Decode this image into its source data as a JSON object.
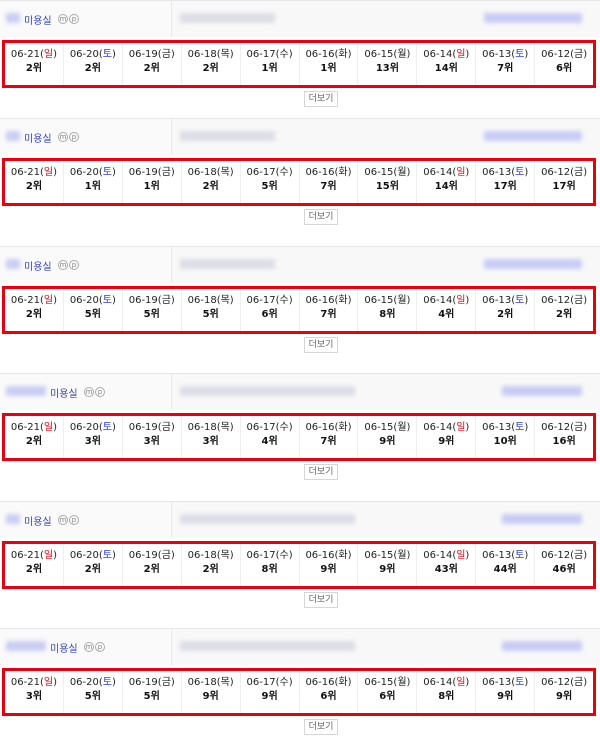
{
  "sections": [
    {
      "shop_suffix": "미용실",
      "more_label": "더보기",
      "days": [
        {
          "date": "06-21",
          "weekday": "일",
          "rank": "2위"
        },
        {
          "date": "06-20",
          "weekday": "토",
          "rank": "2위"
        },
        {
          "date": "06-19",
          "weekday": "금",
          "rank": "2위"
        },
        {
          "date": "06-18",
          "weekday": "목",
          "rank": "2위"
        },
        {
          "date": "06-17",
          "weekday": "수",
          "rank": "1위"
        },
        {
          "date": "06-16",
          "weekday": "화",
          "rank": "1위"
        },
        {
          "date": "06-15",
          "weekday": "월",
          "rank": "13위"
        },
        {
          "date": "06-14",
          "weekday": "일",
          "rank": "14위"
        },
        {
          "date": "06-13",
          "weekday": "토",
          "rank": "7위"
        },
        {
          "date": "06-12",
          "weekday": "금",
          "rank": "6위"
        }
      ]
    },
    {
      "shop_suffix": "미용실",
      "more_label": "더보기",
      "days": [
        {
          "date": "06-21",
          "weekday": "일",
          "rank": "2위"
        },
        {
          "date": "06-20",
          "weekday": "토",
          "rank": "1위"
        },
        {
          "date": "06-19",
          "weekday": "금",
          "rank": "1위"
        },
        {
          "date": "06-18",
          "weekday": "목",
          "rank": "2위"
        },
        {
          "date": "06-17",
          "weekday": "수",
          "rank": "5위"
        },
        {
          "date": "06-16",
          "weekday": "화",
          "rank": "7위"
        },
        {
          "date": "06-15",
          "weekday": "월",
          "rank": "15위"
        },
        {
          "date": "06-14",
          "weekday": "일",
          "rank": "14위"
        },
        {
          "date": "06-13",
          "weekday": "토",
          "rank": "17위"
        },
        {
          "date": "06-12",
          "weekday": "금",
          "rank": "17위"
        }
      ]
    },
    {
      "shop_suffix": "미용실",
      "more_label": "더보기",
      "days": [
        {
          "date": "06-21",
          "weekday": "일",
          "rank": "2위"
        },
        {
          "date": "06-20",
          "weekday": "토",
          "rank": "5위"
        },
        {
          "date": "06-19",
          "weekday": "금",
          "rank": "5위"
        },
        {
          "date": "06-18",
          "weekday": "목",
          "rank": "5위"
        },
        {
          "date": "06-17",
          "weekday": "수",
          "rank": "6위"
        },
        {
          "date": "06-16",
          "weekday": "화",
          "rank": "7위"
        },
        {
          "date": "06-15",
          "weekday": "월",
          "rank": "8위"
        },
        {
          "date": "06-14",
          "weekday": "일",
          "rank": "4위"
        },
        {
          "date": "06-13",
          "weekday": "토",
          "rank": "2위"
        },
        {
          "date": "06-12",
          "weekday": "금",
          "rank": "2위"
        }
      ]
    },
    {
      "shop_suffix": "미용실",
      "more_label": "더보기",
      "days": [
        {
          "date": "06-21",
          "weekday": "일",
          "rank": "2위"
        },
        {
          "date": "06-20",
          "weekday": "토",
          "rank": "3위"
        },
        {
          "date": "06-19",
          "weekday": "금",
          "rank": "3위"
        },
        {
          "date": "06-18",
          "weekday": "목",
          "rank": "3위"
        },
        {
          "date": "06-17",
          "weekday": "수",
          "rank": "4위"
        },
        {
          "date": "06-16",
          "weekday": "화",
          "rank": "7위"
        },
        {
          "date": "06-15",
          "weekday": "월",
          "rank": "9위"
        },
        {
          "date": "06-14",
          "weekday": "일",
          "rank": "9위"
        },
        {
          "date": "06-13",
          "weekday": "토",
          "rank": "10위"
        },
        {
          "date": "06-12",
          "weekday": "금",
          "rank": "16위"
        }
      ]
    },
    {
      "shop_suffix": "미용실",
      "more_label": "더보기",
      "days": [
        {
          "date": "06-21",
          "weekday": "일",
          "rank": "2위"
        },
        {
          "date": "06-20",
          "weekday": "토",
          "rank": "2위"
        },
        {
          "date": "06-19",
          "weekday": "금",
          "rank": "2위"
        },
        {
          "date": "06-18",
          "weekday": "목",
          "rank": "2위"
        },
        {
          "date": "06-17",
          "weekday": "수",
          "rank": "8위"
        },
        {
          "date": "06-16",
          "weekday": "화",
          "rank": "9위"
        },
        {
          "date": "06-15",
          "weekday": "월",
          "rank": "9위"
        },
        {
          "date": "06-14",
          "weekday": "일",
          "rank": "43위"
        },
        {
          "date": "06-13",
          "weekday": "토",
          "rank": "44위"
        },
        {
          "date": "06-12",
          "weekday": "금",
          "rank": "46위"
        }
      ]
    },
    {
      "shop_suffix": "미용실",
      "more_label": "더보기",
      "days": [
        {
          "date": "06-21",
          "weekday": "일",
          "rank": "3위"
        },
        {
          "date": "06-20",
          "weekday": "토",
          "rank": "5위"
        },
        {
          "date": "06-19",
          "weekday": "금",
          "rank": "5위"
        },
        {
          "date": "06-18",
          "weekday": "목",
          "rank": "9위"
        },
        {
          "date": "06-17",
          "weekday": "수",
          "rank": "9위"
        },
        {
          "date": "06-16",
          "weekday": "화",
          "rank": "6위"
        },
        {
          "date": "06-15",
          "weekday": "월",
          "rank": "6위"
        },
        {
          "date": "06-14",
          "weekday": "일",
          "rank": "8위"
        },
        {
          "date": "06-13",
          "weekday": "토",
          "rank": "9위"
        },
        {
          "date": "06-12",
          "weekday": "금",
          "rank": "9위"
        }
      ]
    }
  ],
  "icon_letters": [
    "m",
    "p"
  ],
  "colors": {
    "highlight_border": "#e8000b",
    "sunday": "#e8000b",
    "saturday": "#2b3fc6",
    "shop_link": "#3344bb"
  }
}
